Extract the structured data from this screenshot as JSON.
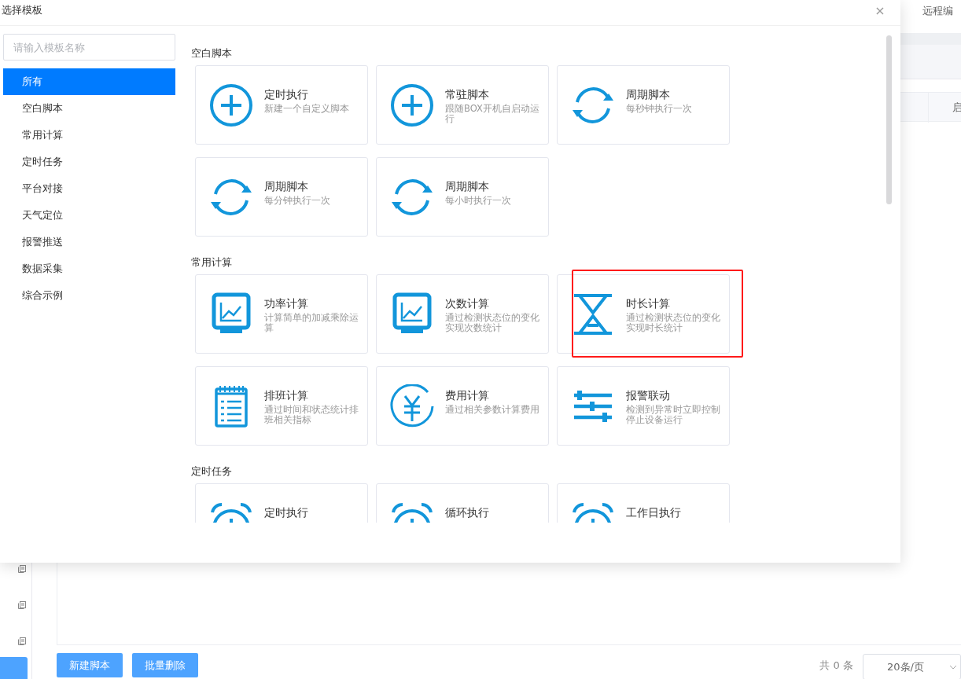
{
  "background": {
    "tab_label": "远程编",
    "column_header": "启",
    "footer_buttons": [
      "新建脚本",
      "批量删除"
    ],
    "total": "共 0 条",
    "page_size": "20条/页"
  },
  "dialog": {
    "title": "选择模板",
    "close": "×",
    "search": {
      "placeholder": "请输入模板名称"
    },
    "categories": [
      {
        "label": "所有",
        "selected": true
      },
      {
        "label": "空白脚本",
        "selected": false
      },
      {
        "label": "常用计算",
        "selected": false
      },
      {
        "label": "定时任务",
        "selected": false
      },
      {
        "label": "平台对接",
        "selected": false
      },
      {
        "label": "天气定位",
        "selected": false
      },
      {
        "label": "报警推送",
        "selected": false
      },
      {
        "label": "数据采集",
        "selected": false
      },
      {
        "label": "综合示例",
        "selected": false
      }
    ],
    "sections": [
      {
        "heading": "空白脚本",
        "templates": [
          {
            "kind": "plus",
            "title": "定时执行",
            "description": "新建一个自定义脚本",
            "highlighted": false
          },
          {
            "kind": "plus",
            "title": "常驻脚本",
            "description": "跟随BOX开机自启动运行",
            "highlighted": false
          },
          {
            "kind": "cycle",
            "title": "周期脚本",
            "description": "每秒钟执行一次",
            "highlighted": false
          },
          {
            "kind": "cycle",
            "title": "周期脚本",
            "description": "每分钟执行一次",
            "highlighted": false
          },
          {
            "kind": "cycle",
            "title": "周期脚本",
            "description": "每小时执行一次",
            "highlighted": false
          }
        ]
      },
      {
        "heading": "常用计算",
        "templates": [
          {
            "kind": "monitor",
            "title": "功率计算",
            "description": "计算简单的加减乘除运算",
            "highlighted": false
          },
          {
            "kind": "monitor",
            "title": "次数计算",
            "description": "通过检测状态位的变化实现次数统计",
            "highlighted": false
          },
          {
            "kind": "hourglass",
            "title": "时长计算",
            "description": "通过检测状态位的变化实现时长统计",
            "highlighted": true
          },
          {
            "kind": "notepad",
            "title": "排班计算",
            "description": "通过时间和状态统计排班相关指标",
            "highlighted": false
          },
          {
            "kind": "yen",
            "title": "费用计算",
            "description": "通过相关参数计算费用",
            "highlighted": false
          },
          {
            "kind": "sliders",
            "title": "报警联动",
            "description": "检测到异常时立即控制停止设备运行",
            "highlighted": false
          }
        ]
      },
      {
        "heading": "定时任务",
        "templates": [
          {
            "kind": "alarm",
            "title": "定时执行",
            "highlighted": false
          },
          {
            "kind": "alarm",
            "title": "循环执行",
            "highlighted": false
          },
          {
            "kind": "alarm",
            "title": "工作日执行",
            "highlighted": false
          }
        ]
      }
    ]
  }
}
